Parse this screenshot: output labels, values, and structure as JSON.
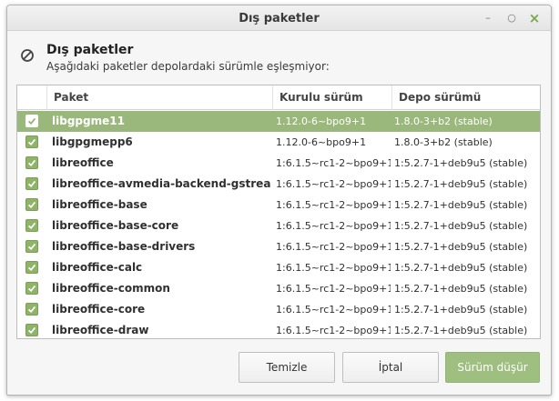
{
  "window": {
    "title": "Dış paketler",
    "controls": [
      "minimize-icon",
      "restore-icon",
      "close-icon"
    ]
  },
  "header": {
    "icon": "forbidden-icon",
    "title": "Dış paketler",
    "subtitle": "Aşağıdaki paketler depolardaki sürümle eşleşmiyor:"
  },
  "table": {
    "columns": [
      "",
      "Paket",
      "Kurulu sürüm",
      "Depo sürümü"
    ],
    "rows": [
      {
        "package": "libgpgme11",
        "installed": "1.12.0-6~bpo9+1",
        "repo": "1.8.0-3+b2 (stable)",
        "checked": true,
        "selected": true
      },
      {
        "package": "libgpgmepp6",
        "installed": "1.12.0-6~bpo9+1",
        "repo": "1.8.0-3+b2 (stable)",
        "checked": true,
        "selected": false
      },
      {
        "package": "libreoffice",
        "installed": "1:6.1.5~rc1-2~bpo9+1",
        "repo": "1:5.2.7-1+deb9u5 (stable)",
        "checked": true,
        "selected": false
      },
      {
        "package": "libreoffice-avmedia-backend-gstreamer",
        "installed": "1:6.1.5~rc1-2~bpo9+1",
        "repo": "1:5.2.7-1+deb9u5 (stable)",
        "checked": true,
        "selected": false
      },
      {
        "package": "libreoffice-base",
        "installed": "1:6.1.5~rc1-2~bpo9+1",
        "repo": "1:5.2.7-1+deb9u5 (stable)",
        "checked": true,
        "selected": false
      },
      {
        "package": "libreoffice-base-core",
        "installed": "1:6.1.5~rc1-2~bpo9+1",
        "repo": "1:5.2.7-1+deb9u5 (stable)",
        "checked": true,
        "selected": false
      },
      {
        "package": "libreoffice-base-drivers",
        "installed": "1:6.1.5~rc1-2~bpo9+1",
        "repo": "1:5.2.7-1+deb9u5 (stable)",
        "checked": true,
        "selected": false
      },
      {
        "package": "libreoffice-calc",
        "installed": "1:6.1.5~rc1-2~bpo9+1",
        "repo": "1:5.2.7-1+deb9u5 (stable)",
        "checked": true,
        "selected": false
      },
      {
        "package": "libreoffice-common",
        "installed": "1:6.1.5~rc1-2~bpo9+1",
        "repo": "1:5.2.7-1+deb9u5 (stable)",
        "checked": true,
        "selected": false
      },
      {
        "package": "libreoffice-core",
        "installed": "1:6.1.5~rc1-2~bpo9+1",
        "repo": "1:5.2.7-1+deb9u5 (stable)",
        "checked": true,
        "selected": false
      },
      {
        "package": "libreoffice-draw",
        "installed": "1:6.1.5~rc1-2~bpo9+1",
        "repo": "1:5.2.7-1+deb9u5 (stable)",
        "checked": true,
        "selected": false
      }
    ]
  },
  "buttons": {
    "clean": "Temizle",
    "cancel": "İptal",
    "downgrade": "Sürüm düşür"
  },
  "colors": {
    "accent": "#9ab87c",
    "checkbox": "#8fb369"
  }
}
